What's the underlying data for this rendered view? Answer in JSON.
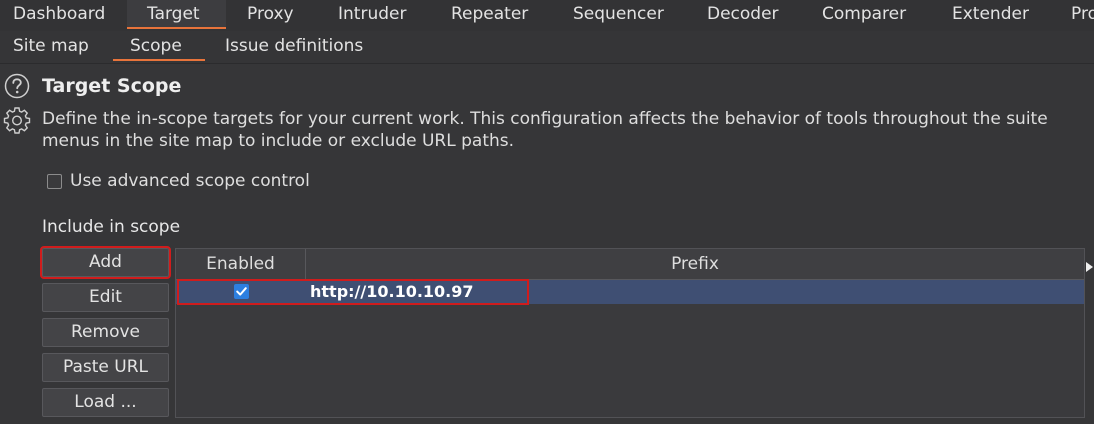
{
  "main_tabs": [
    {
      "label": "Dashboard"
    },
    {
      "label": "Target"
    },
    {
      "label": "Proxy"
    },
    {
      "label": "Intruder"
    },
    {
      "label": "Repeater"
    },
    {
      "label": "Sequencer"
    },
    {
      "label": "Decoder"
    },
    {
      "label": "Comparer"
    },
    {
      "label": "Extender"
    },
    {
      "label": "Pro"
    }
  ],
  "active_main_tab": "Target",
  "sub_tabs": [
    {
      "label": "Site map"
    },
    {
      "label": "Scope"
    },
    {
      "label": "Issue definitions"
    }
  ],
  "active_sub_tab": "Scope",
  "scope": {
    "title": "Target Scope",
    "description_line1": "Define the in-scope targets for your current work. This configuration affects the behavior of tools throughout the suite",
    "description_line2": "menus in the site map to include or exclude URL paths.",
    "advanced_label": "Use advanced scope control",
    "advanced_checked": false,
    "include_heading": "Include in scope",
    "buttons": {
      "add": "Add",
      "edit": "Edit",
      "remove": "Remove",
      "paste_url": "Paste URL",
      "load": "Load ..."
    },
    "table": {
      "headers": {
        "enabled": "Enabled",
        "prefix": "Prefix"
      },
      "rows": [
        {
          "enabled": true,
          "prefix": "http://10.10.10.97"
        }
      ]
    }
  },
  "colors": {
    "accent": "#e8743b",
    "highlight_box": "#d01c1c",
    "selected_row": "#3f4f73",
    "checkbox_blue": "#2d7fe0"
  },
  "icons": {
    "help": "help-icon",
    "settings": "gear-icon",
    "check": "check-icon",
    "expand": "expand-arrow-icon"
  }
}
